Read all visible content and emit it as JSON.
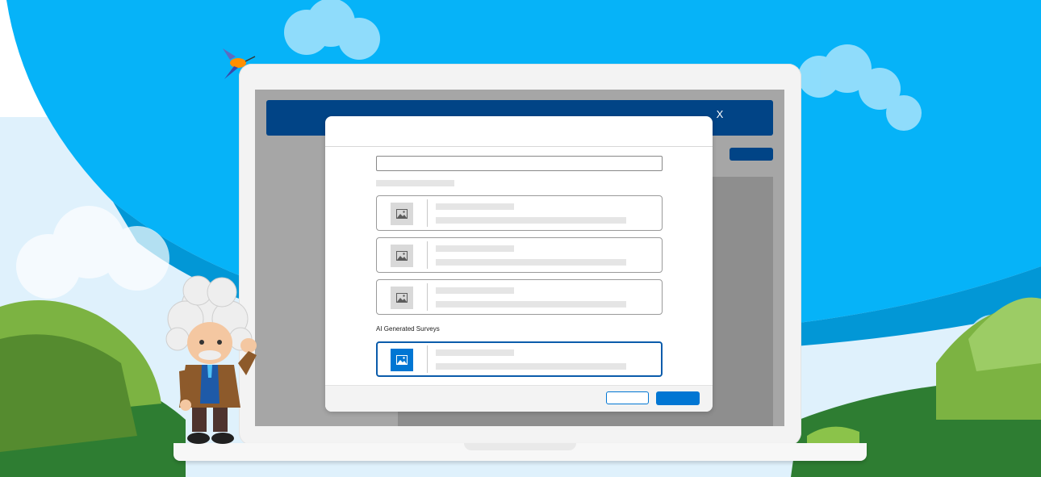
{
  "colors": {
    "sky_blue": "#06b3f8",
    "header_navy": "#014486",
    "brand_blue": "#0176d3",
    "selected_border": "#0b5cab",
    "screen_gray": "#a6a6a6"
  },
  "app": {
    "close_label": "X"
  },
  "modal": {
    "section_label": "AI Generated Surveys",
    "items": [
      {
        "icon": "image-placeholder-icon",
        "selected": false
      },
      {
        "icon": "image-placeholder-icon",
        "selected": false
      },
      {
        "icon": "image-placeholder-icon",
        "selected": false
      },
      {
        "icon": "image-placeholder-icon",
        "selected": true
      }
    ]
  },
  "illustration": {
    "characters": [
      "einstein-mascot",
      "hummingbird"
    ]
  }
}
